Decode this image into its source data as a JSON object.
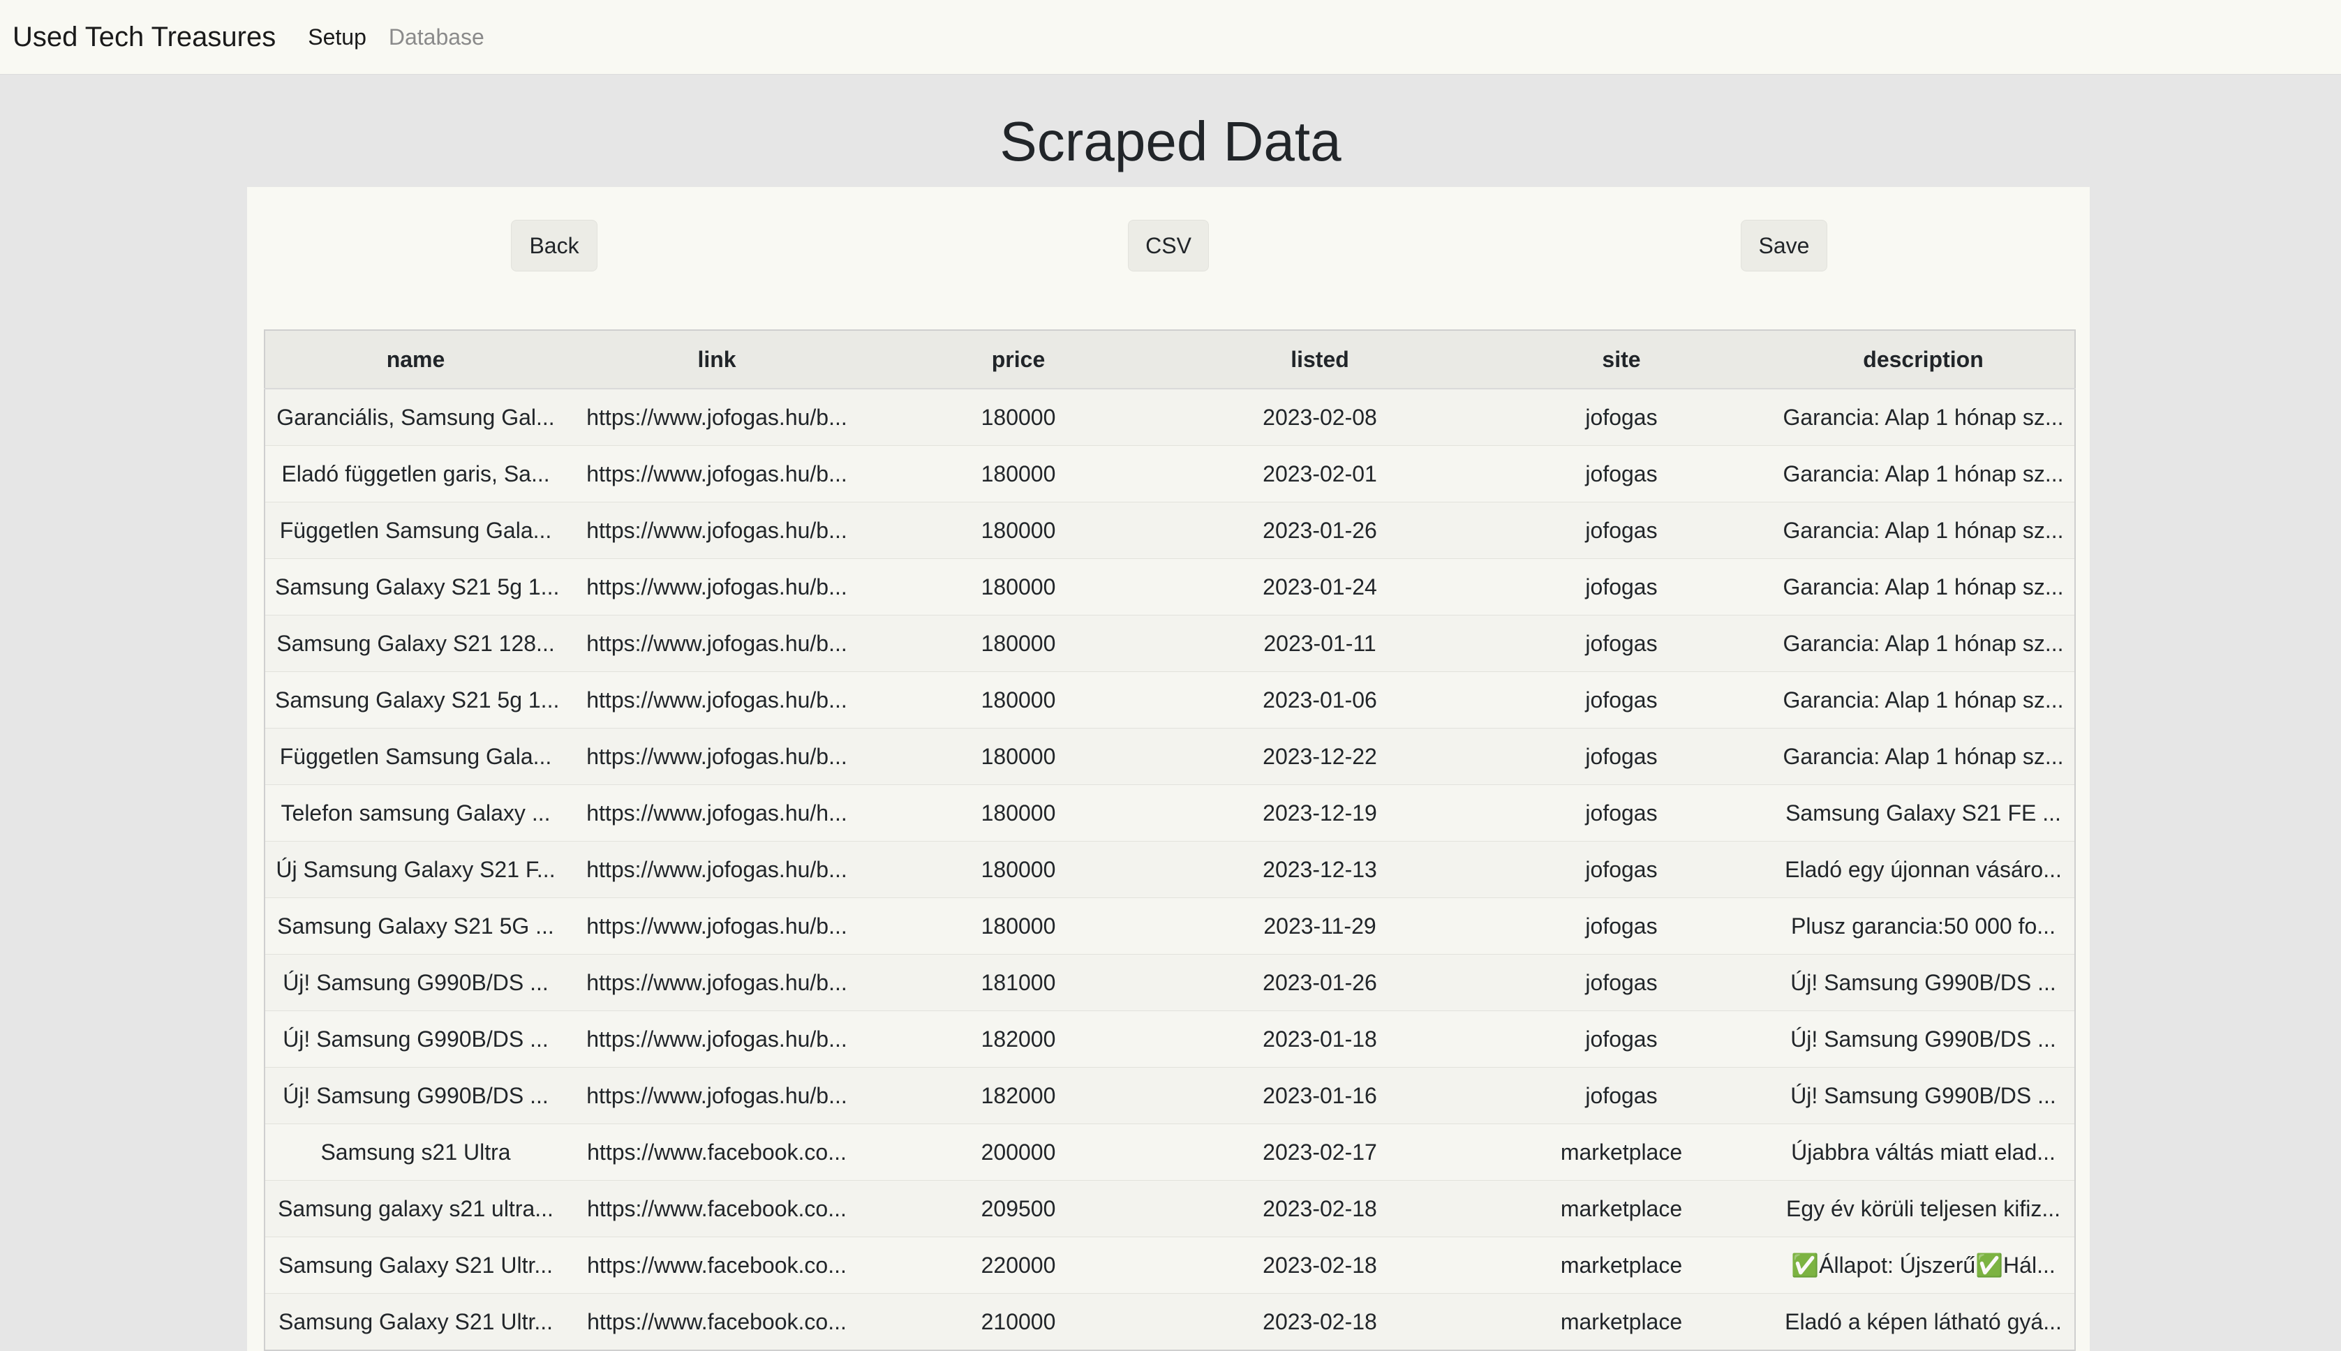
{
  "navbar": {
    "brand": "Used Tech Treasures",
    "links": [
      {
        "label": "Setup"
      },
      {
        "label": "Database"
      }
    ]
  },
  "page": {
    "title": "Scraped Data"
  },
  "toolbar": {
    "back_label": "Back",
    "csv_label": "CSV",
    "save_label": "Save"
  },
  "table": {
    "columns": [
      "name",
      "link",
      "price",
      "listed",
      "site",
      "description"
    ],
    "rows": [
      {
        "name": "Garanciális, Samsung Gal...",
        "link": "https://www.jofogas.hu/b...",
        "price": "180000",
        "listed": "2023-02-08",
        "site": "jofogas",
        "description": "Garancia: Alap 1 hónap sz..."
      },
      {
        "name": "Eladó független garis, Sa...",
        "link": "https://www.jofogas.hu/b...",
        "price": "180000",
        "listed": "2023-02-01",
        "site": "jofogas",
        "description": "Garancia: Alap 1 hónap sz..."
      },
      {
        "name": "Független Samsung Gala...",
        "link": "https://www.jofogas.hu/b...",
        "price": "180000",
        "listed": "2023-01-26",
        "site": "jofogas",
        "description": "Garancia: Alap 1 hónap sz..."
      },
      {
        "name": "Samsung Galaxy S21 5g 1...",
        "link": "https://www.jofogas.hu/b...",
        "price": "180000",
        "listed": "2023-01-24",
        "site": "jofogas",
        "description": "Garancia: Alap 1 hónap sz..."
      },
      {
        "name": "Samsung Galaxy S21 128...",
        "link": "https://www.jofogas.hu/b...",
        "price": "180000",
        "listed": "2023-01-11",
        "site": "jofogas",
        "description": "Garancia: Alap 1 hónap sz..."
      },
      {
        "name": "Samsung Galaxy S21 5g 1...",
        "link": "https://www.jofogas.hu/b...",
        "price": "180000",
        "listed": "2023-01-06",
        "site": "jofogas",
        "description": "Garancia: Alap 1 hónap sz..."
      },
      {
        "name": "Független Samsung Gala...",
        "link": "https://www.jofogas.hu/b...",
        "price": "180000",
        "listed": "2023-12-22",
        "site": "jofogas",
        "description": "Garancia: Alap 1 hónap sz..."
      },
      {
        "name": "Telefon samsung Galaxy ...",
        "link": "https://www.jofogas.hu/h...",
        "price": "180000",
        "listed": "2023-12-19",
        "site": "jofogas",
        "description": "Samsung Galaxy S21 FE ..."
      },
      {
        "name": "Új Samsung Galaxy S21 F...",
        "link": "https://www.jofogas.hu/b...",
        "price": "180000",
        "listed": "2023-12-13",
        "site": "jofogas",
        "description": "Eladó egy újonnan vásáro..."
      },
      {
        "name": "Samsung Galaxy S21 5G ...",
        "link": "https://www.jofogas.hu/b...",
        "price": "180000",
        "listed": "2023-11-29",
        "site": "jofogas",
        "description": "Plusz garancia:50 000 fo..."
      },
      {
        "name": "Új! Samsung G990B/DS ...",
        "link": "https://www.jofogas.hu/b...",
        "price": "181000",
        "listed": "2023-01-26",
        "site": "jofogas",
        "description": "Új! Samsung G990B/DS ..."
      },
      {
        "name": "Új! Samsung G990B/DS ...",
        "link": "https://www.jofogas.hu/b...",
        "price": "182000",
        "listed": "2023-01-18",
        "site": "jofogas",
        "description": "Új! Samsung G990B/DS ..."
      },
      {
        "name": "Új! Samsung G990B/DS ...",
        "link": "https://www.jofogas.hu/b...",
        "price": "182000",
        "listed": "2023-01-16",
        "site": "jofogas",
        "description": "Új! Samsung G990B/DS ..."
      },
      {
        "name": "Samsung s21 Ultra",
        "link": "https://www.facebook.co...",
        "price": "200000",
        "listed": "2023-02-17",
        "site": "marketplace",
        "description": "Újabbra váltás miatt elad..."
      },
      {
        "name": "Samsung galaxy s21 ultra...",
        "link": "https://www.facebook.co...",
        "price": "209500",
        "listed": "2023-02-18",
        "site": "marketplace",
        "description": "Egy év körüli teljesen kifiz..."
      },
      {
        "name": "Samsung Galaxy S21 Ultr...",
        "link": "https://www.facebook.co...",
        "price": "220000",
        "listed": "2023-02-18",
        "site": "marketplace",
        "description": "✅Állapot: Újszerű✅Hál..."
      },
      {
        "name": "Samsung Galaxy S21 Ultr...",
        "link": "https://www.facebook.co...",
        "price": "210000",
        "listed": "2023-02-18",
        "site": "marketplace",
        "description": "Eladó a képen látható gyá..."
      }
    ]
  }
}
